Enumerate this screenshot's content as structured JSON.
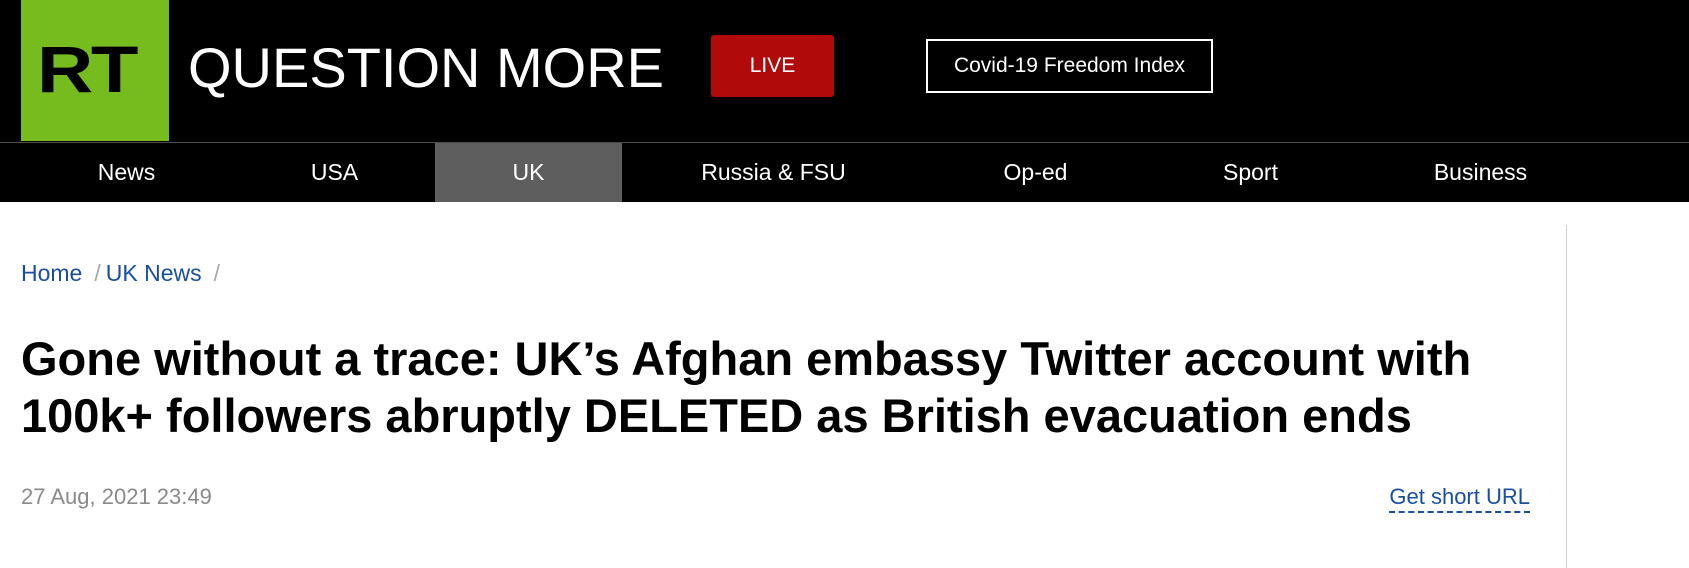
{
  "header": {
    "logo_text": "RT",
    "tagline": "QUESTION MORE",
    "live_label": "LIVE",
    "covid_label": "Covid-19 Freedom Index",
    "colors": {
      "brand_green": "#77bc1f",
      "live_red": "#b10a0a"
    }
  },
  "nav": {
    "items": [
      {
        "label": "News"
      },
      {
        "label": "USA"
      },
      {
        "label": "UK",
        "active": true
      },
      {
        "label": "Russia & FSU"
      },
      {
        "label": "Op-ed"
      },
      {
        "label": "Sport"
      },
      {
        "label": "Business"
      }
    ]
  },
  "breadcrumb": {
    "items": [
      {
        "label": "Home"
      },
      {
        "label": "UK News"
      }
    ],
    "separator": "/"
  },
  "article": {
    "headline": "Gone without a trace: UK’s Afghan embassy Twitter account with 100k+ followers abruptly DELETED as British evacuation ends",
    "date": "27 Aug, 2021 23:49",
    "short_url_label": "Get short URL"
  }
}
